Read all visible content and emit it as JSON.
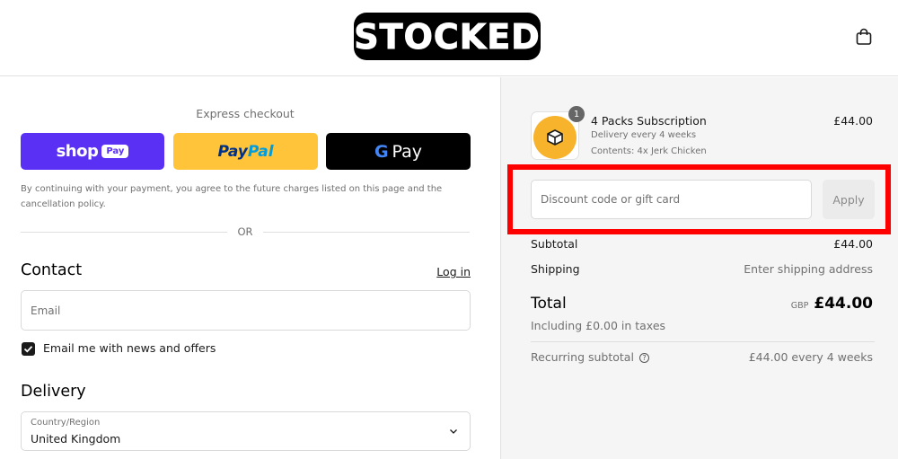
{
  "brand": {
    "logo_text": "STOCKED",
    "bag_icon": "shopping-bag-icon"
  },
  "express": {
    "title": "Express checkout",
    "shop_label": "shop",
    "shop_badge": "Pay",
    "paypal_part1": "Pay",
    "paypal_part2": "Pal",
    "gpay_g": "G",
    "gpay_label": "Pay",
    "consent": "By continuing with your payment, you agree to the future charges listed on this page and the cancellation policy.",
    "or_text": "OR"
  },
  "contact": {
    "heading": "Contact",
    "login_link": "Log in",
    "email_placeholder": "Email",
    "newsletter_label": "Email me with news and offers",
    "newsletter_checked": true
  },
  "delivery": {
    "heading": "Delivery",
    "country_label": "Country/Region",
    "country_value": "United Kingdom"
  },
  "summary": {
    "item": {
      "quantity": "1",
      "name": "4 Packs Subscription",
      "frequency": "Delivery every 4 weeks",
      "contents": "Contents: 4x Jerk Chicken",
      "price": "£44.00",
      "icon": "box-icon"
    },
    "discount_placeholder": "Discount code or gift card",
    "apply_label": "Apply",
    "subtotal_label": "Subtotal",
    "subtotal_value": "£44.00",
    "shipping_label": "Shipping",
    "shipping_value": "Enter shipping address",
    "total_label": "Total",
    "currency": "GBP",
    "total_value": "£44.00",
    "taxes_note": "Including £0.00 in taxes",
    "recurring_label": "Recurring subtotal",
    "recurring_value": "£44.00 every 4 weeks"
  },
  "colors": {
    "shop_pay": "#5a31f4",
    "paypal": "#ffc439",
    "gpay": "#000000",
    "highlight": "#ff0000",
    "summary_bg": "#f5f5f5"
  }
}
